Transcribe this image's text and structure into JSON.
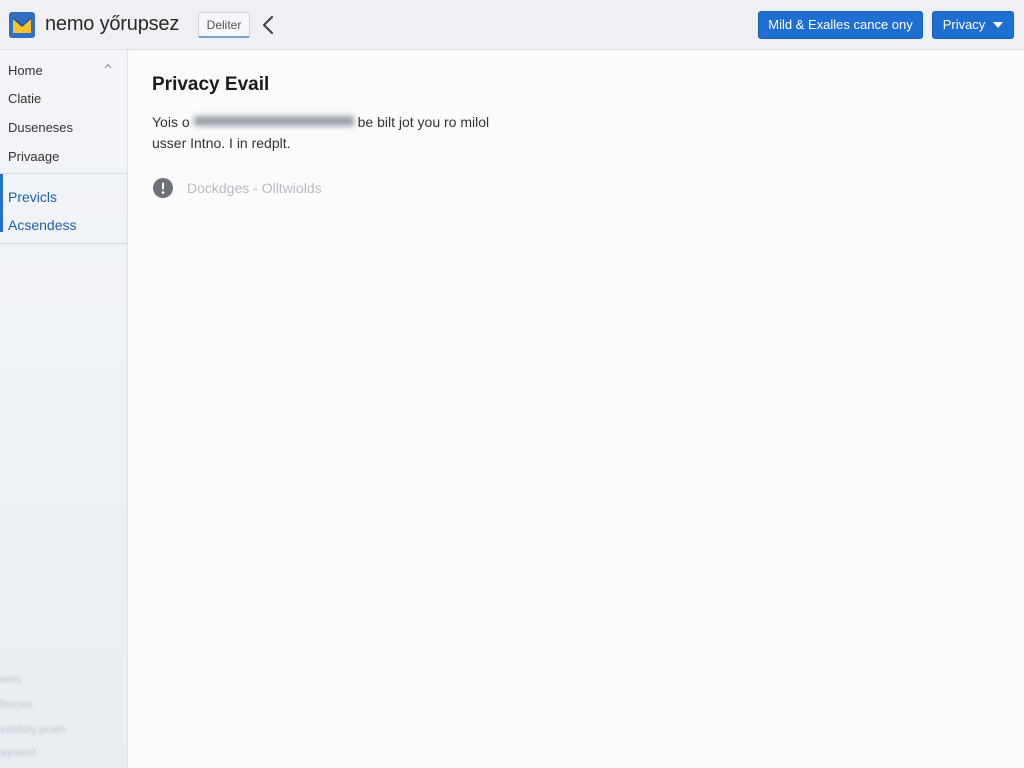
{
  "header": {
    "app_title": "nemo yőrupsez",
    "tab_label": "Deliter",
    "action_button": "Mild & Exalles cance ony",
    "privacy_button": "Privacy"
  },
  "sidebar": {
    "items": [
      {
        "label": "Home"
      },
      {
        "label": "Clatie"
      },
      {
        "label": "Duseneses"
      },
      {
        "label": "Privaage"
      }
    ],
    "links": [
      {
        "label": "Previcls"
      },
      {
        "label": "Acsendess"
      }
    ],
    "faded_items": [
      "wes",
      "hooss",
      "veldsly.poen",
      "ayoent"
    ]
  },
  "main": {
    "title": "Privacy Evail",
    "description_start": "Yois o",
    "description_end": "be bilt jot you ro milol",
    "description_line2": "usser Intno. I in redplt.",
    "status_text": "Dockdges - Olltwiolds"
  },
  "colors": {
    "accent": "#1f6fd1",
    "link": "#1f5fb0"
  }
}
